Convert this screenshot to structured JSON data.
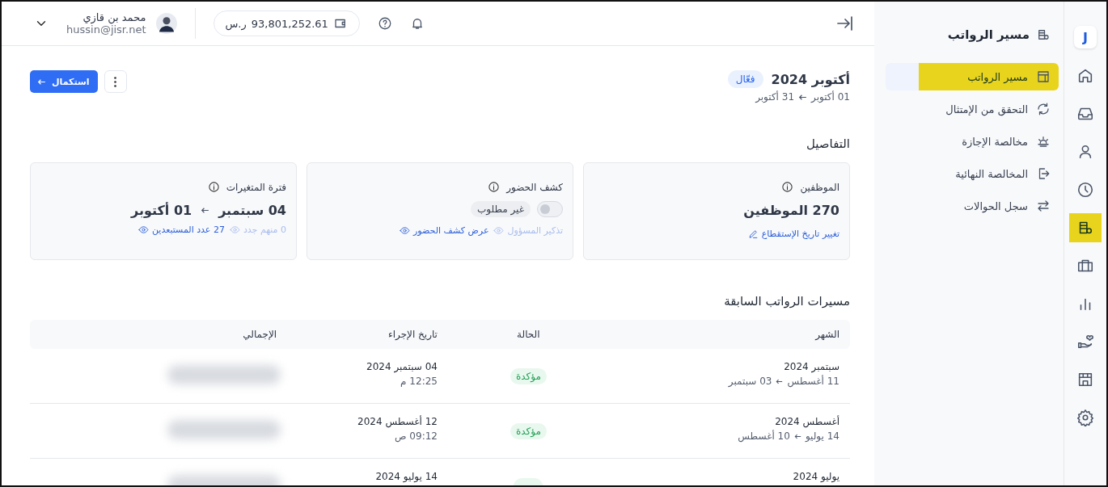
{
  "rail": {
    "logo": "J",
    "items": [
      {
        "selected": false
      },
      {
        "selected": false
      },
      {
        "selected": false
      },
      {
        "selected": false
      },
      {
        "selected": true
      },
      {
        "selected": false
      },
      {
        "selected": false
      },
      {
        "selected": false
      },
      {
        "selected": false
      },
      {
        "selected": false
      }
    ]
  },
  "sidebar": {
    "title": "مسير الرواتب",
    "items": [
      {
        "label": "مسير الرواتب",
        "selected": true
      },
      {
        "label": "التحقق من الإمتثال",
        "selected": false
      },
      {
        "label": "مخالصة الإجازة",
        "selected": false
      },
      {
        "label": "المخالصة النهائية",
        "selected": false
      },
      {
        "label": "سجل الحوالات",
        "selected": false
      }
    ]
  },
  "topbar": {
    "balance": "93,801,252.61",
    "currency": "ر.س",
    "user_name": "محمد بن قازي",
    "user_email": "hussin@jisr.net"
  },
  "header": {
    "title": "أكتوبر 2024",
    "status": "فعّال",
    "from": "01 أكتوبر",
    "to": "31 أكتوبر",
    "primary_button": "استكمال"
  },
  "details": {
    "title": "التفاصيل",
    "cards": [
      {
        "kind": "employees",
        "title": "الموظفين",
        "value": "270 الموظفين",
        "link": "تغيير تاريخ الإستقطاع"
      },
      {
        "kind": "attendance",
        "title": "كشف الحضور",
        "toggle_on": false,
        "badge": "غير مطلوب",
        "muted_link": "تذكير المسؤول",
        "link": "عرض كشف الحضور"
      },
      {
        "kind": "period",
        "title": "فترة المتغيرات",
        "from": "04 سبتمبر",
        "to": "01 أكتوبر",
        "muted_link": "0 منهم جدد",
        "link": "27 عدد المستبعدين"
      }
    ]
  },
  "history": {
    "title": "مسيرات الرواتب السابقة",
    "columns": [
      "الشهر",
      "الحالة",
      "تاريخ الإجراء",
      "الإجمالي"
    ],
    "rows": [
      {
        "month": "سبتمبر 2024",
        "from": "11 أغسطس",
        "to": "03 سبتمبر",
        "status": "مؤكدة",
        "date": "04 سبتمبر 2024",
        "time": "12:25 م"
      },
      {
        "month": "أغسطس 2024",
        "from": "14 يوليو",
        "to": "10 أغسطس",
        "status": "مؤكدة",
        "date": "12 أغسطس 2024",
        "time": "09:12 ص"
      },
      {
        "month": "يوليو 2024",
        "date": "14 يوليو 2024"
      }
    ]
  }
}
